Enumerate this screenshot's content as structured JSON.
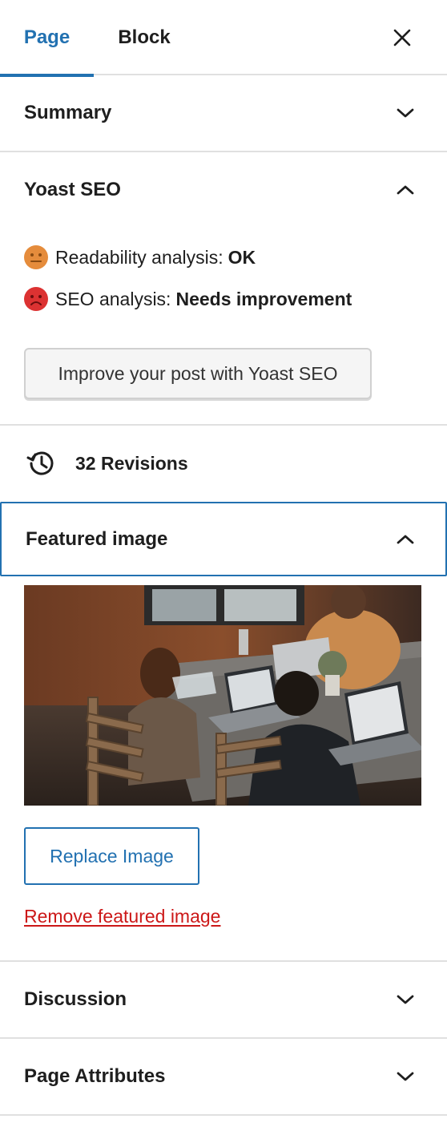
{
  "tabs": {
    "page_label": "Page",
    "block_label": "Block"
  },
  "panels": {
    "summary_label": "Summary",
    "yoast_label": "Yoast SEO",
    "featured_label": "Featured image",
    "discussion_label": "Discussion",
    "attributes_label": "Page Attributes"
  },
  "yoast": {
    "readability_prefix": "Readability analysis:",
    "readability_status": "OK",
    "seo_prefix": "SEO analysis:",
    "seo_status": "Needs improvement",
    "improve_button": "Improve your post with Yoast SEO"
  },
  "revisions": {
    "label": "32 Revisions"
  },
  "featured_image": {
    "replace_button": "Replace Image",
    "remove_link": "Remove featured image"
  },
  "colors": {
    "accent": "#2271b1",
    "danger": "#cc1818",
    "ok_face": "#e58c3c",
    "bad_face": "#dc3232"
  }
}
